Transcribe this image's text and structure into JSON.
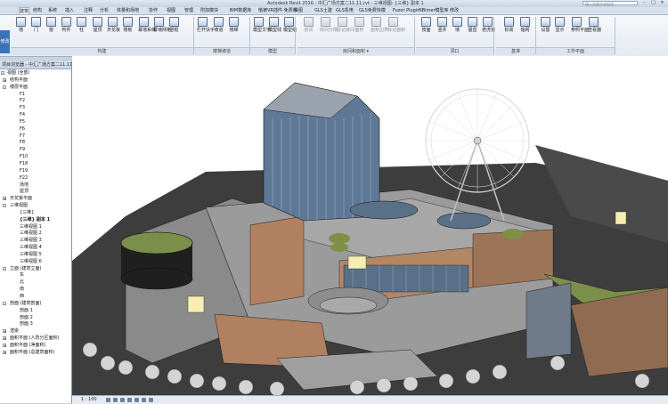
{
  "window": {
    "title": "Autodesk Revit 2016 -    中汇广场方案二11.11.rvt - 三维视图: {三维} 副本 1",
    "search_placeholder": "键入关键字或短语",
    "min": "–",
    "max": "□",
    "close": "✕"
  },
  "menu_tabs": [
    "建筑",
    "结构",
    "系统",
    "插入",
    "注释",
    "分析",
    "体量和场地",
    "协作",
    "视图",
    "管理",
    "附加模块",
    "BIM数据库",
    "植被VR插件-免费版",
    "快图",
    "GLS土建",
    "GLS机电",
    "GLS免费快模",
    "Fuzor Plugin",
    "NBimer模型库",
    "修改"
  ],
  "ribbon": {
    "left_label": "修改",
    "buttons": [
      "墙",
      "门",
      "窗",
      "构件",
      "柱",
      "屋顶",
      "天花板",
      "楼板",
      "幕墙系统",
      "幕墙网格",
      "竖梃",
      "栏杆扶手",
      "坡道",
      "楼梯",
      "模型文字",
      "模型线",
      "模型组",
      "房间",
      "房间分隔",
      "标记房间",
      "面积",
      "面积边界",
      "标记面积",
      "按面",
      "竖井",
      "墙",
      "垂直",
      "老虎窗",
      "标高",
      "轴网",
      "设置",
      "显示",
      "参照平面",
      "查看器"
    ],
    "panels": [
      "构建",
      "楼梯坡道",
      "模型",
      "房间和面积 ▾",
      "洞口",
      "基准",
      "工作平面"
    ]
  },
  "browser": {
    "header": "项目浏览器 - 中汇广场方案二11.11.rvt",
    "items": [
      {
        "text": "视图 (全部)",
        "level": 0,
        "exp": "-"
      },
      {
        "text": "结构平面",
        "level": 1,
        "exp": "+"
      },
      {
        "text": "楼层平面",
        "level": 1,
        "exp": "-"
      },
      {
        "text": "F1",
        "level": 2
      },
      {
        "text": "F2",
        "level": 2
      },
      {
        "text": "F3",
        "level": 2
      },
      {
        "text": "F4",
        "level": 2
      },
      {
        "text": "F5",
        "level": 2
      },
      {
        "text": "F6",
        "level": 2
      },
      {
        "text": "F7",
        "level": 2
      },
      {
        "text": "F8",
        "level": 2
      },
      {
        "text": "F9",
        "level": 2
      },
      {
        "text": "F10",
        "level": 2
      },
      {
        "text": "F18",
        "level": 2
      },
      {
        "text": "F19",
        "level": 2
      },
      {
        "text": "F22",
        "level": 2
      },
      {
        "text": "场地",
        "level": 2
      },
      {
        "text": "屋顶",
        "level": 2
      },
      {
        "text": "天花板平面",
        "level": 1,
        "exp": "+"
      },
      {
        "text": "三维视图",
        "level": 1,
        "exp": "-"
      },
      {
        "text": "{三维}",
        "level": 2
      },
      {
        "text": "{三维} 副本 1",
        "level": 2,
        "bold": true
      },
      {
        "text": "三维视图 1",
        "level": 2
      },
      {
        "text": "三维视图 2",
        "level": 2
      },
      {
        "text": "三维视图 3",
        "level": 2
      },
      {
        "text": "三维视图 4",
        "level": 2
      },
      {
        "text": "三维视图 5",
        "level": 2
      },
      {
        "text": "三维视图 6",
        "level": 2
      },
      {
        "text": "立面 (建筑立面)",
        "level": 1,
        "exp": "-"
      },
      {
        "text": "东",
        "level": 2
      },
      {
        "text": "北",
        "level": 2
      },
      {
        "text": "南",
        "level": 2
      },
      {
        "text": "西",
        "level": 2
      },
      {
        "text": "剖面 (建筑剖面)",
        "level": 1,
        "exp": "-"
      },
      {
        "text": "剖面 1",
        "level": 2
      },
      {
        "text": "剖面 2",
        "level": 2
      },
      {
        "text": "剖面 3",
        "level": 2
      },
      {
        "text": "渲染",
        "level": 1,
        "exp": "+"
      },
      {
        "text": "面积平面 (人防分区面积)",
        "level": 1,
        "exp": "+"
      },
      {
        "text": "面积平面 (净面积)",
        "level": 1,
        "exp": "+"
      },
      {
        "text": "面积平面 (总建筑面积)",
        "level": 1,
        "exp": "+"
      }
    ]
  },
  "view_bar": {
    "scale": "1 : 100"
  }
}
